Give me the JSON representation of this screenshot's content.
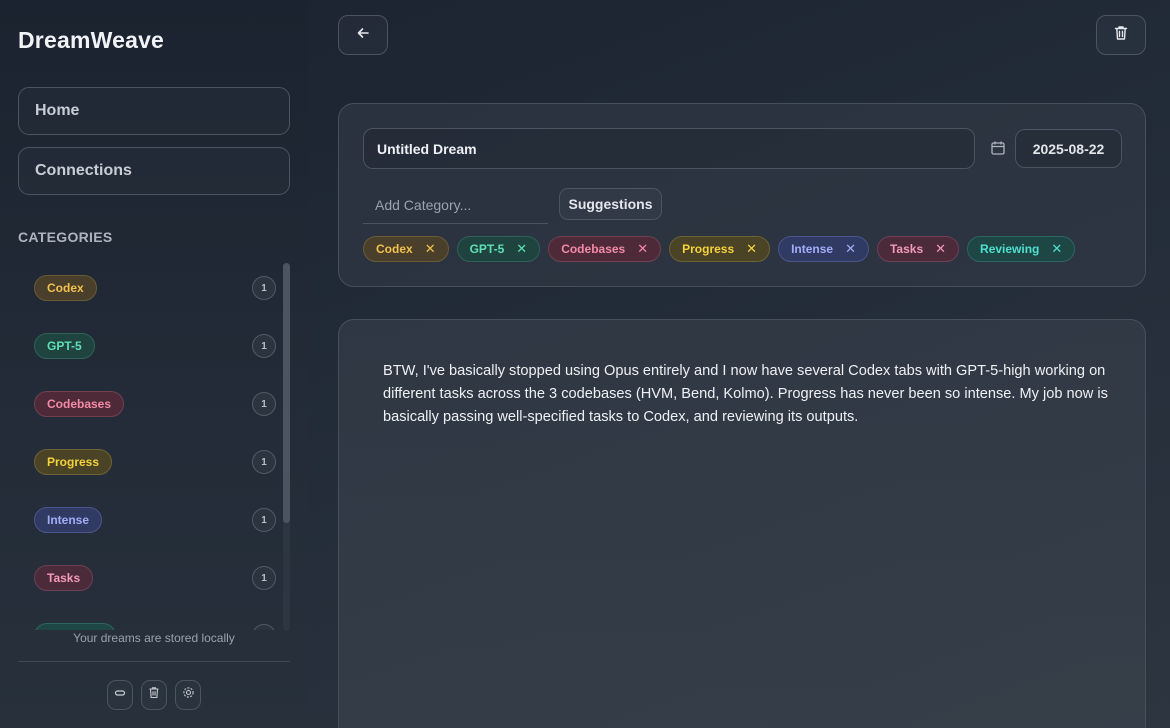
{
  "app": {
    "title": "DreamWeave"
  },
  "sidebar": {
    "nav": [
      {
        "label": "Home"
      },
      {
        "label": "Connections"
      }
    ],
    "categories_heading": "CATEGORIES",
    "categories": [
      {
        "label": "Codex",
        "count": "1",
        "color": "#f2c14e"
      },
      {
        "label": "GPT-5",
        "count": "1",
        "color": "#5fe0b4"
      },
      {
        "label": "Codebases",
        "count": "1",
        "color": "#f38aa8"
      },
      {
        "label": "Progress",
        "count": "1",
        "color": "#f5d33c"
      },
      {
        "label": "Intense",
        "count": "1",
        "color": "#a3adf8"
      },
      {
        "label": "Tasks",
        "count": "1",
        "color": "#f49ab6"
      }
    ],
    "stored_note": "Your dreams are stored locally",
    "footer_icons": [
      "link-icon",
      "trash-icon",
      "settings-icon"
    ]
  },
  "editor": {
    "title_value": "Untitled Dream",
    "date_value": "2025-08-22",
    "category_placeholder": "Add Category...",
    "suggestions_label": "Suggestions",
    "remove_symbol": "✕",
    "tags": [
      {
        "label": "Codex"
      },
      {
        "label": "GPT-5"
      },
      {
        "label": "Codebases"
      },
      {
        "label": "Progress"
      },
      {
        "label": "Intense"
      },
      {
        "label": "Tasks"
      },
      {
        "label": "Reviewing"
      }
    ],
    "content": "BTW, I've basically stopped using Opus entirely and I now have several Codex tabs with GPT-5-high working on different tasks across the 3 codebases (HVM, Bend, Kolmo). Progress has never been so intense. My job now is basically passing well-specified tasks to Codex, and reviewing its outputs."
  }
}
